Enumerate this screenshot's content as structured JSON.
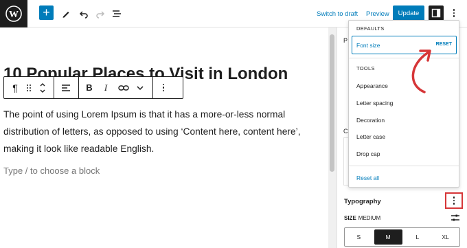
{
  "topbar": {
    "switch_to_draft": "Switch to draft",
    "preview": "Preview",
    "update": "Update",
    "accent_color": "#007cba"
  },
  "editor": {
    "title": "10 Popular Places to Visit in London",
    "paragraph": "The point of using Lorem Ipsum is that it has a more-or-less normal distribution of letters, as opposed to using ‘Content here, content here’, making it look like readable English.",
    "placeholder": "Type / to choose a block",
    "block_toolbar": {
      "paragraph_icon": "¶",
      "bold": "B",
      "italic": "I"
    }
  },
  "sidebar": {
    "fragment_p": "P",
    "fragment_c": "C",
    "typography_label": "Typography",
    "size_label": "SIZE",
    "size_value": "MEDIUM",
    "size_options": [
      "S",
      "M",
      "L",
      "XL"
    ],
    "selected_size": "M"
  },
  "dropdown": {
    "defaults_heading": "DEFAULTS",
    "font_size_label": "Font size",
    "font_size_reset": "RESET",
    "tools_heading": "TOOLS",
    "tools": [
      "Appearance",
      "Letter spacing",
      "Decoration",
      "Letter case",
      "Drop cap"
    ],
    "reset_all": "Reset all"
  },
  "annotations": {
    "highlight_color": "#d63638"
  }
}
